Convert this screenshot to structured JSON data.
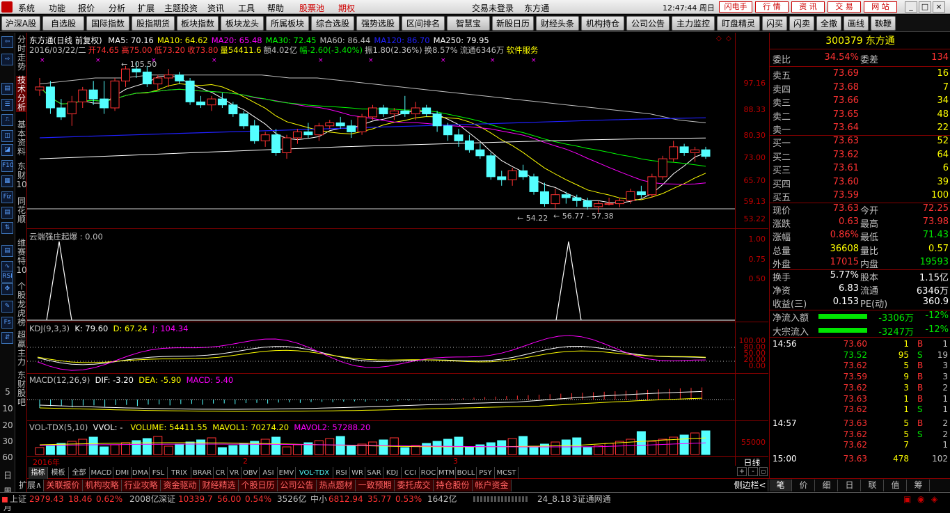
{
  "menubar": {
    "items": [
      "系统",
      "功能",
      "报价",
      "分析",
      "扩展",
      "主题投资",
      "资讯",
      "工具",
      "帮助"
    ],
    "red_items": [
      "股票池",
      "期权"
    ],
    "login_status": "交易未登录",
    "stock_name": "东方通",
    "clock": "12:47:44 周日",
    "buttons": [
      "闪电手",
      "行 情",
      "资 讯",
      "交 易",
      "网 站"
    ]
  },
  "toolbar": {
    "buttons": [
      "沪深A股",
      "自选股",
      "国际指数",
      "股指期货",
      "板块指数",
      "板块龙头",
      "所属板块",
      "综合选股",
      "强势选股",
      "区间排名",
      "智慧宝",
      "新股日历",
      "财经头条",
      "机构持仓",
      "公司公告",
      "主力监控",
      "盯盘精灵",
      "闪买",
      "闪卖",
      "全撤",
      "画线",
      "鞅鞭"
    ]
  },
  "side_tabs": [
    "分时走势",
    "技术分析",
    "基本资料",
    "东财10",
    "同花顺",
    "维赛特10",
    "个股龙虎榜",
    "超赢主力",
    "东财股吧"
  ],
  "left_icons": [
    "⇦",
    "⇨",
    "▤",
    "☰",
    "⎍",
    "◫",
    "◪",
    "F10",
    "▦",
    "Fiz",
    "▤",
    "⇅",
    "▤",
    "∿",
    "RSI",
    "✥",
    "✎",
    "Fs",
    "⇵"
  ],
  "left_numbers": [
    "5",
    "10",
    "20",
    "30",
    "60",
    "日",
    "周",
    "月"
  ],
  "main": {
    "title": "东方通(日线 前复权)",
    "ma": [
      {
        "label": "MA5: 70.16",
        "color": "#ffffff"
      },
      {
        "label": "MA10: 64.62",
        "color": "#ffff00"
      },
      {
        "label": "MA20: 65.48",
        "color": "#ff00ff"
      },
      {
        "label": "MA30: 72.45",
        "color": "#00ff00"
      },
      {
        "label": "MA60: 86.44",
        "color": "#c0c0c0"
      },
      {
        "label": "MA120: 86.70",
        "color": "#2020ff"
      },
      {
        "label": "MA250: 79.95",
        "color": "#ffffff"
      }
    ],
    "ohlc_line": [
      {
        "t": "2016/03/22/二",
        "c": "#c0c0c0"
      },
      {
        "t": "开74.65",
        "c": "#ff3232"
      },
      {
        "t": "高75.00",
        "c": "#ff3232"
      },
      {
        "t": "低73.20",
        "c": "#ff3232"
      },
      {
        "t": "收73.80",
        "c": "#ff3232"
      },
      {
        "t": "量54411.6",
        "c": "#ffff00"
      },
      {
        "t": "额4.02亿",
        "c": "#c0c0c0"
      },
      {
        "t": "幅-2.60(-3.40%)",
        "c": "#00e600"
      },
      {
        "t": "振1.80(2.36%)",
        "c": "#c0c0c0"
      },
      {
        "t": "换8.57%",
        "c": "#c0c0c0"
      },
      {
        "t": "流通6346万",
        "c": "#c0c0c0"
      },
      {
        "t": "软件服务",
        "c": "#ffff00"
      }
    ],
    "yticks": [
      "97.16",
      "88.33",
      "80.30",
      "73.00",
      "65.70",
      "59.13",
      "53.22"
    ],
    "annotations": {
      "high": "105.50",
      "low": "54.22",
      "range": "56.77 - 57.38"
    },
    "candles_ohlc": [
      [
        96,
        100,
        94,
        97
      ],
      [
        97,
        99,
        88,
        90
      ],
      [
        90,
        93,
        86,
        87
      ],
      [
        88,
        94,
        84,
        92
      ],
      [
        92,
        97,
        90,
        96
      ],
      [
        96,
        99,
        91,
        93
      ],
      [
        93,
        99,
        88,
        90
      ],
      [
        90,
        100,
        89,
        99
      ],
      [
        99,
        104,
        97,
        103
      ],
      [
        103,
        105.5,
        100,
        102
      ],
      [
        102,
        104,
        97,
        98
      ],
      [
        98,
        101,
        96,
        100
      ],
      [
        100,
        103,
        97,
        101
      ],
      [
        101,
        102,
        98,
        99
      ],
      [
        99,
        100,
        91,
        92
      ],
      [
        92,
        94,
        90,
        91
      ],
      [
        91,
        94,
        89,
        93
      ],
      [
        93,
        95,
        90,
        91
      ],
      [
        91,
        92,
        87,
        88
      ],
      [
        88,
        89,
        83,
        84
      ],
      [
        84,
        86,
        78,
        79
      ],
      [
        79,
        82,
        77,
        81
      ],
      [
        81,
        83,
        74,
        75
      ],
      [
        75,
        81,
        73,
        80
      ],
      [
        80,
        83,
        78,
        82
      ],
      [
        82,
        85,
        80,
        81
      ],
      [
        81,
        85,
        79,
        84
      ],
      [
        84,
        86,
        83,
        85
      ],
      [
        85,
        87,
        83,
        84
      ],
      [
        84,
        86,
        80,
        82
      ],
      [
        82,
        88,
        81,
        87
      ],
      [
        87,
        91,
        86,
        90
      ],
      [
        90,
        91,
        87,
        88
      ],
      [
        88,
        90,
        86,
        89
      ],
      [
        89,
        94,
        87,
        88
      ],
      [
        88,
        92,
        86,
        90
      ],
      [
        90,
        91,
        87,
        88
      ],
      [
        88,
        89,
        82,
        84
      ],
      [
        84,
        85,
        79,
        81
      ],
      [
        81,
        83,
        77,
        79
      ],
      [
        79,
        81,
        75,
        76
      ],
      [
        76,
        78,
        73,
        74
      ],
      [
        74,
        75,
        66,
        67
      ],
      [
        67,
        69,
        64,
        66
      ],
      [
        66,
        70,
        64,
        69
      ],
      [
        69,
        71,
        66,
        67
      ],
      [
        67,
        68,
        61,
        62
      ],
      [
        62,
        65,
        57,
        58
      ],
      [
        58,
        63,
        56,
        61
      ],
      [
        61,
        62,
        58,
        60
      ],
      [
        60,
        61,
        57,
        59
      ],
      [
        59,
        60,
        56,
        57
      ],
      [
        57,
        59,
        55,
        58
      ],
      [
        58,
        60,
        57.4,
        58
      ],
      [
        58,
        60,
        56.8,
        59
      ],
      [
        59,
        63,
        58,
        62
      ],
      [
        62,
        64,
        60,
        61
      ],
      [
        61,
        68,
        60,
        67
      ],
      [
        67,
        74,
        66,
        73
      ],
      [
        73,
        79,
        72,
        77
      ],
      [
        77,
        78,
        74,
        75
      ],
      [
        75,
        77,
        72,
        76
      ],
      [
        76,
        77,
        73,
        73.8
      ]
    ]
  },
  "indicator1": {
    "label": "云端强庄起爆 : 0.00",
    "yticks": [
      "1.00",
      "0.75",
      "0.50"
    ]
  },
  "kdj": {
    "name": "KDJ(9,3,3)",
    "k": "K: 79.60",
    "d": "D: 67.24",
    "j": "J: 104.34",
    "yticks": [
      "100.00",
      "80.00",
      "50.00",
      "20.00",
      "0.00"
    ]
  },
  "macd": {
    "name": "MACD(12,26,9)",
    "dif": "DIF: -3.20",
    "dea": "DEA: -5.90",
    "macd": "MACD: 5.40"
  },
  "vol": {
    "name": "VOL-TDX(5,10)",
    "vvol": "VVOL: -",
    "volume": "VOLUME: 54411.55",
    "mavol1": "MAVOL1: 70274.20",
    "mavol2": "MAVOL2: 57288.20",
    "ytick": "55000",
    "xlabels": [
      "2016年",
      "2",
      "3"
    ],
    "period": "日线"
  },
  "bottom_tabs": [
    "指标",
    "模板",
    "全部",
    "MACD",
    "DMI",
    "DMA",
    "FSL",
    "TRIX",
    "BRAR",
    "CR",
    "VR",
    "OBV",
    "ASI",
    "EMV",
    "VOL-TDX",
    "RSI",
    "WR",
    "SAR",
    "KDJ",
    "CCI",
    "ROC",
    "MTM",
    "BOLL",
    "PSY",
    "MCST"
  ],
  "bottom_tabs2": [
    "扩展∧",
    "关联报价",
    "机构攻略",
    "行业攻略",
    "资金驱动",
    "财经精选",
    "个股日历",
    "公司公告",
    "热点题材",
    "一致预期",
    "委托成交",
    "持仓股份",
    "帐户资金"
  ],
  "side_toggle": "侧边栏<",
  "info": {
    "code": "300379",
    "name": "东方通",
    "weibi_label": "委比",
    "weibi": "34.54%",
    "weicha_label": "委差",
    "weicha": "134",
    "asks": [
      [
        "卖五",
        "73.69",
        "16"
      ],
      [
        "卖四",
        "73.68",
        "7"
      ],
      [
        "卖三",
        "73.66",
        "34"
      ],
      [
        "卖二",
        "73.65",
        "48"
      ],
      [
        "卖一",
        "73.64",
        "22"
      ]
    ],
    "bids": [
      [
        "买一",
        "73.63",
        "52"
      ],
      [
        "买二",
        "73.62",
        "64"
      ],
      [
        "买三",
        "73.61",
        "6"
      ],
      [
        "买四",
        "73.60",
        "39"
      ],
      [
        "买五",
        "73.59",
        "100"
      ]
    ],
    "quote": [
      [
        "现价",
        "73.63",
        "今开",
        "72.25"
      ],
      [
        "涨跌",
        "0.63",
        "最高",
        "73.98"
      ],
      [
        "涨幅",
        "0.86%",
        "最低",
        "71.43"
      ],
      [
        "总量",
        "36608",
        "量比",
        "0.57"
      ],
      [
        "外盘",
        "17015",
        "内盘",
        "19593"
      ]
    ],
    "fund": [
      [
        "换手",
        "5.77%",
        "股本",
        "1.15亿"
      ],
      [
        "净资",
        "6.83",
        "流通",
        "6346万"
      ],
      [
        "收益(三)",
        "0.153",
        "PE(动)",
        "360.9"
      ]
    ],
    "flows": [
      [
        "净流入额",
        "-3306万",
        "-12%"
      ],
      [
        "大宗流入",
        "-3247万",
        "-12%"
      ]
    ],
    "ticks": [
      [
        "14:56",
        "73.60",
        "1",
        "B",
        "1"
      ],
      [
        "",
        "73.52",
        "95",
        "S",
        "19"
      ],
      [
        "",
        "73.62",
        "5",
        "B",
        "3"
      ],
      [
        "",
        "73.59",
        "9",
        "B",
        "3"
      ],
      [
        "",
        "73.62",
        "3",
        "B",
        "2"
      ],
      [
        "",
        "73.63",
        "1",
        "B",
        "1"
      ],
      [
        "",
        "73.62",
        "1",
        "S",
        "1"
      ],
      [
        "14:57",
        "73.63",
        "5",
        "B",
        "2"
      ],
      [
        "",
        "73.62",
        "5",
        "S",
        "2"
      ],
      [
        "",
        "73.62",
        "7",
        "",
        "1"
      ],
      [
        "15:00",
        "73.63",
        "478",
        "",
        "102"
      ]
    ],
    "tabs": [
      "笔",
      "价",
      "细",
      "日",
      "联",
      "值",
      "筹"
    ]
  },
  "statusbar": {
    "items": [
      {
        "t": "上证",
        "c": "#c0c0c0"
      },
      {
        "t": "2979.43",
        "c": "#ff3232"
      },
      {
        "t": "18.46",
        "c": "#ff3232"
      },
      {
        "t": "0.62%",
        "c": "#ff3232"
      },
      {
        "t": "2008亿",
        "c": "#c0c0c0"
      },
      {
        "t": "深证",
        "c": "#c0c0c0"
      },
      {
        "t": "10339.7",
        "c": "#ff3232"
      },
      {
        "t": "56.00",
        "c": "#ff3232"
      },
      {
        "t": "0.54%",
        "c": "#ff3232"
      },
      {
        "t": "3526亿",
        "c": "#c0c0c0"
      },
      {
        "t": "中小",
        "c": "#c0c0c0"
      },
      {
        "t": "6812.94",
        "c": "#ff3232"
      },
      {
        "t": "35.77",
        "c": "#ff3232"
      },
      {
        "t": "0.53%",
        "c": "#ff3232"
      },
      {
        "t": "1642亿",
        "c": "#c0c0c0"
      },
      {
        "t": "24_8.18",
        "c": "#c0c0c0"
      },
      {
        "t": "3证通网通",
        "c": "#c0c0c0"
      }
    ]
  }
}
